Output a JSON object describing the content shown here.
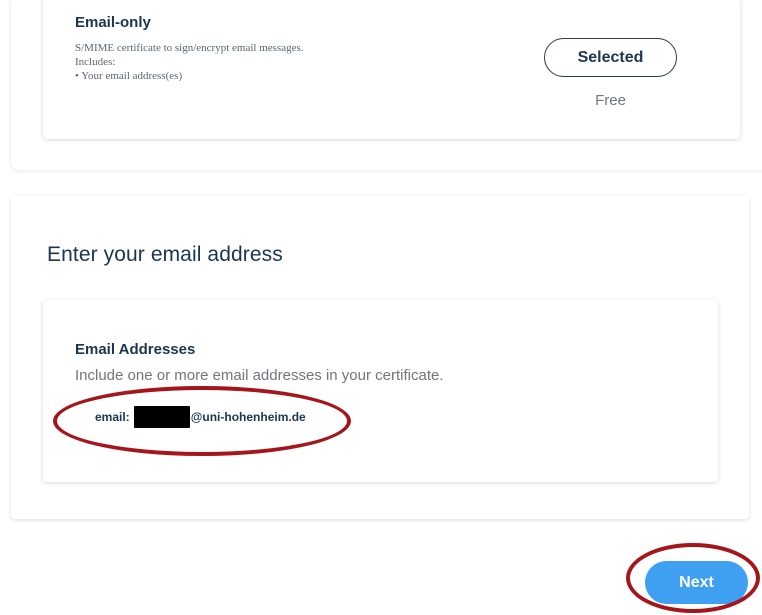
{
  "plan": {
    "title": "Email-only",
    "description": [
      "S/MIME certificate to sign/encrypt email messages.",
      "Includes:",
      "• Your email address(es)"
    ],
    "selected_label": "Selected",
    "price": "Free"
  },
  "email_section": {
    "title": "Enter your email address",
    "field_label": "Email Addresses",
    "help_text": "Include one or more email addresses in your certificate.",
    "email_prefix_label": "email:",
    "email_domain": "@uni-hohenheim.de"
  },
  "actions": {
    "next_label": "Next"
  },
  "colors": {
    "accent": "#3fa0f2",
    "annotation": "#a6141c",
    "heading": "#1c3550"
  }
}
